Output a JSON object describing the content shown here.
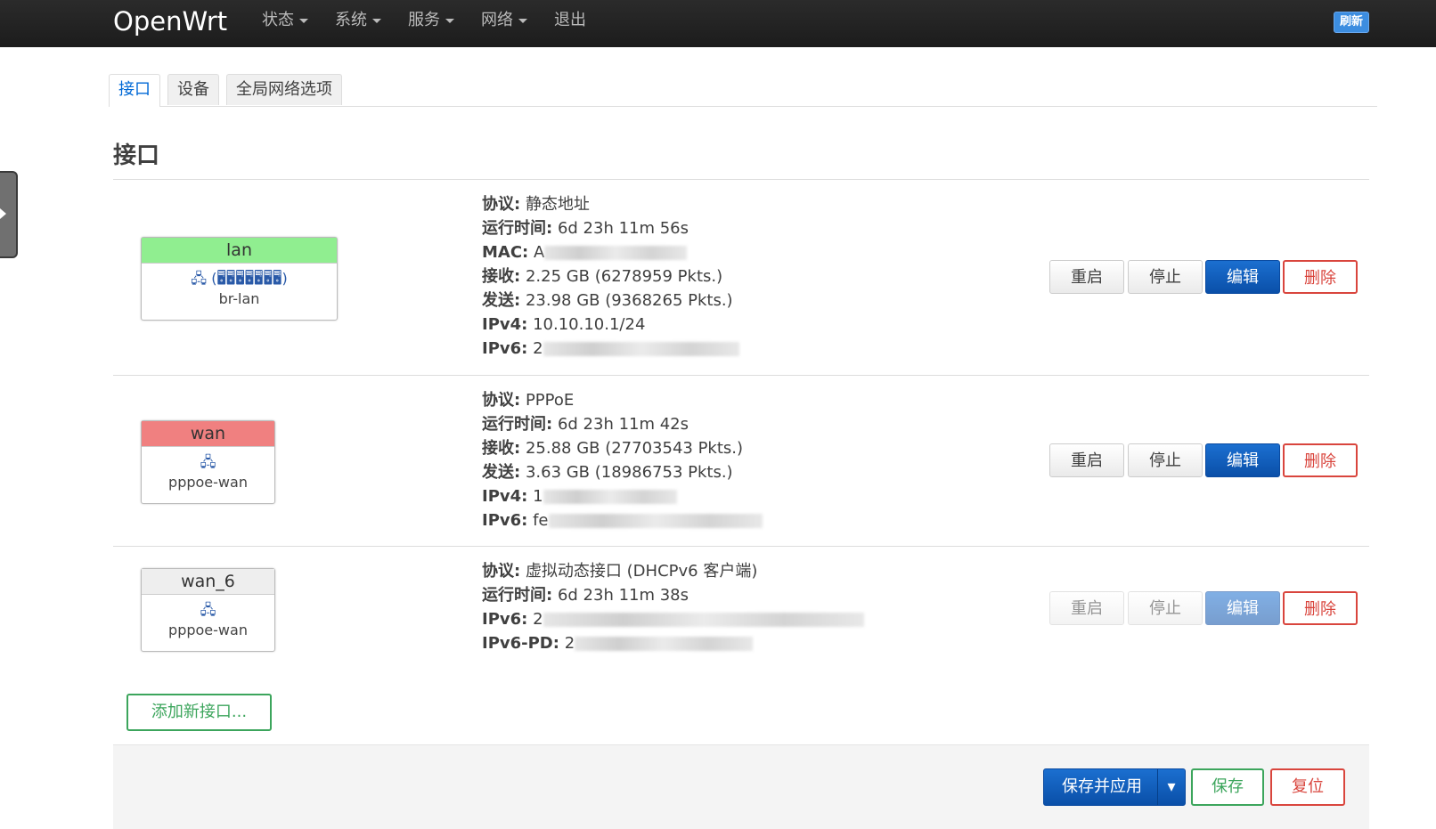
{
  "topbar": {
    "brand": "OpenWrt",
    "menu": [
      "状态",
      "系统",
      "服务",
      "网络",
      "退出"
    ],
    "refresh": "刷新"
  },
  "tabs": [
    "接口",
    "设备",
    "全局网络选项"
  ],
  "page_title": "接口",
  "interfaces": [
    {
      "name": "lan",
      "header_color": "#90ee90",
      "icons": "🖧 (🖥🖥🖥🖥🖥🖥🖥)",
      "device": "br-lan",
      "rows": [
        {
          "label": "协议:",
          "value": "静态地址"
        },
        {
          "label": "运行时间:",
          "value": "6d 23h 11m 56s"
        },
        {
          "label": "MAC:",
          "value": "A"
        },
        {
          "label": "接收:",
          "value": "2.25 GB (6278959 Pkts.)"
        },
        {
          "label": "发送:",
          "value": "23.98 GB (9368265 Pkts.)"
        },
        {
          "label": "IPv4:",
          "value": "10.10.10.1/24"
        },
        {
          "label": "IPv6:",
          "value": "2"
        }
      ],
      "buttons": {
        "restart": "重启",
        "stop": "停止",
        "edit": "编辑",
        "delete": "删除"
      }
    },
    {
      "name": "wan",
      "header_color": "#f08080",
      "icons": "🖧",
      "device": "pppoe-wan",
      "rows": [
        {
          "label": "协议:",
          "value": "PPPoE"
        },
        {
          "label": "运行时间:",
          "value": "6d 23h 11m 42s"
        },
        {
          "label": "接收:",
          "value": "25.88 GB (27703543 Pkts.)"
        },
        {
          "label": "发送:",
          "value": "3.63 GB (18986753 Pkts.)"
        },
        {
          "label": "IPv4:",
          "value": "1"
        },
        {
          "label": "IPv6:",
          "value": "fe"
        }
      ],
      "buttons": {
        "restart": "重启",
        "stop": "停止",
        "edit": "编辑",
        "delete": "删除"
      }
    },
    {
      "name": "wan_6",
      "header_color": "#eeeeee",
      "icons": "🖧",
      "device": "pppoe-wan",
      "rows": [
        {
          "label": "协议:",
          "value": "虚拟动态接口 (DHCPv6 客户端)"
        },
        {
          "label": "运行时间:",
          "value": "6d 23h 11m 38s"
        },
        {
          "label": "IPv6:",
          "value": "2"
        },
        {
          "label": "IPv6-PD:",
          "value": "2"
        }
      ],
      "buttons": {
        "restart": "重启",
        "stop": "停止",
        "edit": "编辑",
        "delete": "删除"
      }
    }
  ],
  "add_interface": "添加新接口...",
  "footer": {
    "save_apply": "保存并应用",
    "dropdown": "▾",
    "save": "保存",
    "reset": "复位"
  }
}
